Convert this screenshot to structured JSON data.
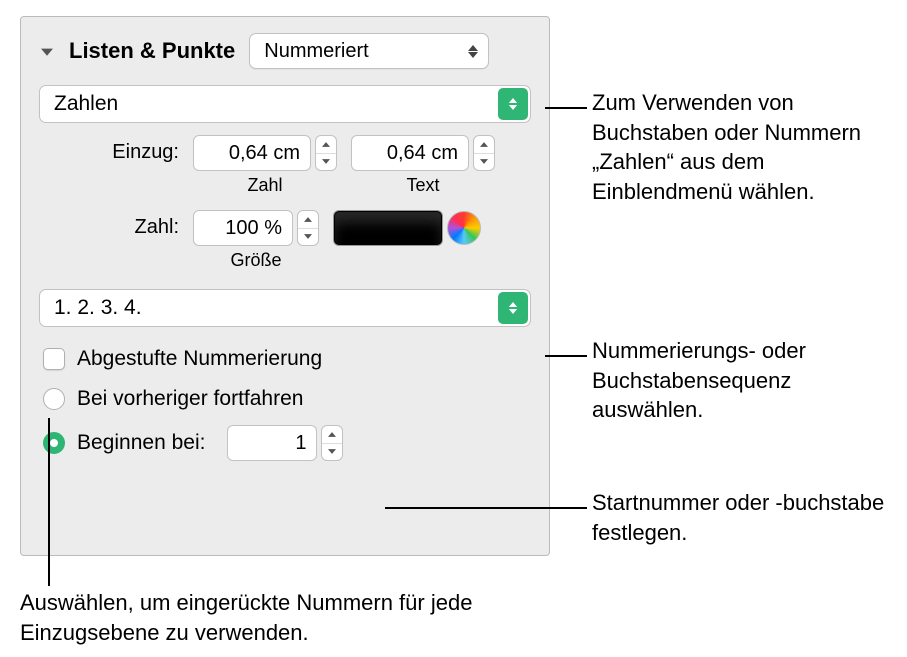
{
  "header": {
    "title": "Listen & Punkte",
    "list_type_value": "Nummeriert"
  },
  "number_type": {
    "value": "Zahlen"
  },
  "indent": {
    "label": "Einzug:",
    "number_value": "0,64 cm",
    "number_sublabel": "Zahl",
    "text_value": "0,64 cm",
    "text_sublabel": "Text"
  },
  "zahl": {
    "label": "Zahl:",
    "size_value": "100 %",
    "size_sublabel": "Größe"
  },
  "sequence": {
    "value": "1. 2. 3. 4."
  },
  "tiered": {
    "label": "Abgestufte Nummerierung"
  },
  "continue": {
    "label": "Bei vorheriger fortfahren"
  },
  "start_at": {
    "label": "Beginnen bei:",
    "value": "1"
  },
  "annotations": {
    "a1": "Zum Verwenden von Buchstaben oder Nummern „Zahlen“ aus dem Einblendmenü wählen.",
    "a2": "Nummerierungs- oder Buchstabensequenz auswählen.",
    "a3": "Startnummer oder -buchstabe festlegen.",
    "a4": "Auswählen, um eingerückte Nummern für jede Einzugsebene zu verwenden."
  }
}
